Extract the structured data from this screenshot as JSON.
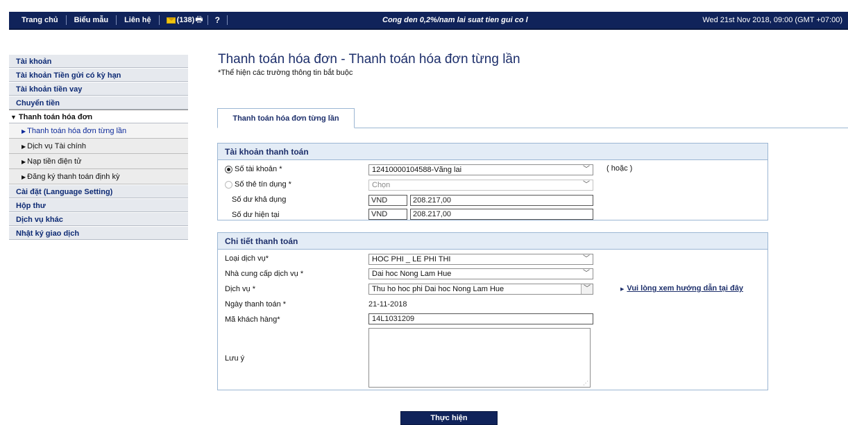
{
  "topnav": {
    "home": "Trang chủ",
    "forms": "Biểu mẫu",
    "contact": "Liên hệ",
    "mail_count": "(138)",
    "help": "?",
    "marquee": "Cong den 0,2%/nam lai suat tien gui co l",
    "datetime": "Wed 21st Nov 2018, 09:00 (GMT +07:00)"
  },
  "sidebar": {
    "items_top": [
      "Tài khoản",
      "Tài khoản Tiền gửi có kỳ hạn",
      "Tài khoản tiền vay",
      "Chuyển tiền"
    ],
    "open_item": "Thanh toán hóa đơn",
    "sub_items": [
      "Thanh toán hóa đơn từng lần",
      "Dịch vụ Tài chính",
      "Nạp tiền điện tử",
      "Đăng ký thanh toán định kỳ"
    ],
    "items_bottom": [
      "Cài đặt (Language Setting)",
      "Hộp thư",
      "Dịch vụ khác",
      "Nhật ký giao dịch"
    ]
  },
  "page": {
    "title": "Thanh toán hóa đơn - Thanh toán hóa đơn từng lần",
    "subtitle": "*Thể hiện các trường thông tin bắt buộc",
    "tab": "Thanh toán hóa đơn từng lần"
  },
  "account_panel": {
    "heading": "Tài khoản thanh toán",
    "account_label": "Số tài khoản *",
    "account_value": "12410000104588-Vãng lai",
    "or_text": "( hoặc )",
    "card_label": "Số thẻ tín dụng *",
    "card_value": "Chọn",
    "available_label": "Số dư khả dụng",
    "available_ccy": "VND",
    "available_amount": "208.217,00",
    "current_label": "Số dư hiện tại",
    "current_ccy": "VND",
    "current_amount": "208.217,00"
  },
  "detail_panel": {
    "heading": "Chi tiết thanh toán",
    "service_type_label": "Loại dịch vụ*",
    "service_type_value": "HOC PHI _ LE PHI THI",
    "provider_label": "Nhà cung cấp dịch vụ *",
    "provider_value": "Dai hoc Nong Lam Hue",
    "service_label": "Dịch vụ *",
    "service_value": "Thu ho hoc phi Dai hoc Nong Lam Hue",
    "guide_link": "Vui lòng xem hướng dẫn tại đây",
    "pay_date_label": "Ngày thanh toán *",
    "pay_date_value": "21-11-2018",
    "customer_code_label": "Mã khách hàng*",
    "customer_code_value": "14L1031209",
    "note_label": "Lưu ý"
  },
  "submit_label": "Thực hiện"
}
